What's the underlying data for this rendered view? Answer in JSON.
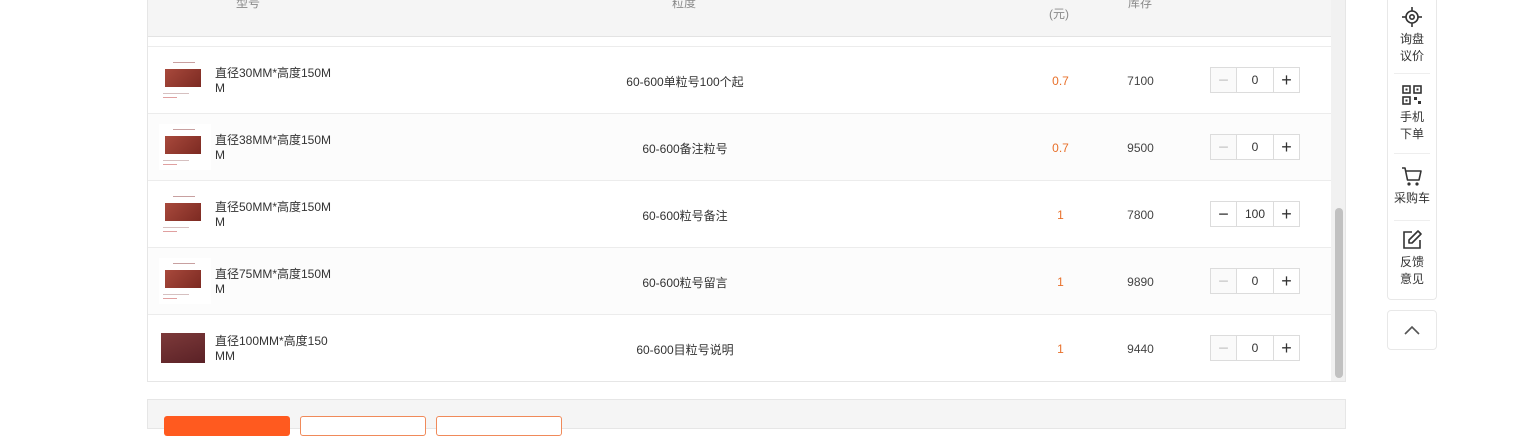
{
  "table": {
    "headers": {
      "model": "型号",
      "grit": "粒度",
      "price": "(元)",
      "stock": "库存"
    },
    "rows": [
      {
        "model": "直径30MM*高度150MM",
        "grit": "60-600单粒号100个起",
        "price": "0.7",
        "stock": "7100",
        "quantity": "0"
      },
      {
        "model": "直径38MM*高度150MM",
        "grit": "60-600备注粒号",
        "price": "0.7",
        "stock": "9500",
        "quantity": "0"
      },
      {
        "model": "直径50MM*高度150MM",
        "grit": "60-600粒号备注",
        "price": "1",
        "stock": "7800",
        "quantity": "100"
      },
      {
        "model": "直径75MM*高度150MM",
        "grit": "60-600粒号留言",
        "price": "1",
        "stock": "9890",
        "quantity": "0"
      },
      {
        "model": "直径100MM*高度150MM",
        "grit": "60-600目粒号说明",
        "price": "1",
        "stock": "9440",
        "quantity": "0"
      }
    ],
    "stepper": {
      "minus": "−",
      "plus": "+"
    }
  },
  "side_toolbar": {
    "items": [
      {
        "icon": "target-icon",
        "label_line1": "询盘",
        "label_line2": "议价"
      },
      {
        "icon": "qrcode-icon",
        "label_line1": "手机",
        "label_line2": "下单"
      },
      {
        "icon": "cart-icon",
        "label_line1": "采购车",
        "label_line2": ""
      },
      {
        "icon": "edit-icon",
        "label_line1": "反馈",
        "label_line2": "意见"
      }
    ],
    "back_to_top_icon": "chevron-up-icon"
  },
  "colors": {
    "price": "#e8702a",
    "primary_button": "#ff5a1f",
    "header_bg": "#f5f5f5"
  }
}
